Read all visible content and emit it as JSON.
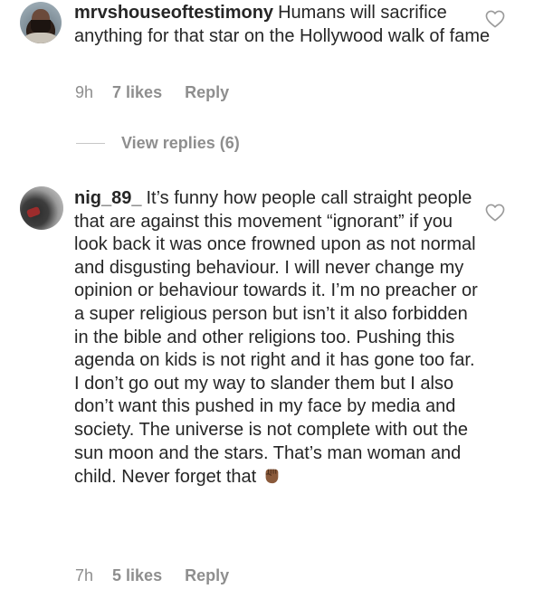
{
  "comments": [
    {
      "username": "mrvshouseoftestimony",
      "text": "Humans will sacrifice anything for that star on the Hollywood walk of fame",
      "time": "9h",
      "likes": "7 likes",
      "reply_label": "Reply",
      "view_replies_label": "View replies (6)"
    },
    {
      "username": "nig_89_",
      "text": "It’s funny how people call straight people that are against this movement “ignorant” if you look back it was once frowned upon as not normal and disgusting behaviour. I will never change my opinion or behaviour towards it. I’m no preacher or a super religious person but isn’t it also forbidden in the bible and other religions too. Pushing this agenda on kids is not right and it has gone too far. I don’t go out my way to slander them but I also don’t want this pushed in my face by media and society. The universe is not complete with out the sun moon and the stars. That’s man woman and child. Never forget that",
      "emoji": "raised-fist-emoji",
      "time": "7h",
      "likes": "5 likes",
      "reply_label": "Reply"
    }
  ],
  "icons": {
    "like": "heart-outline-icon"
  },
  "colors": {
    "text": "#262626",
    "meta": "#8e8e8e",
    "divider": "#c7c7c7",
    "fist": "#8a5a3b"
  }
}
